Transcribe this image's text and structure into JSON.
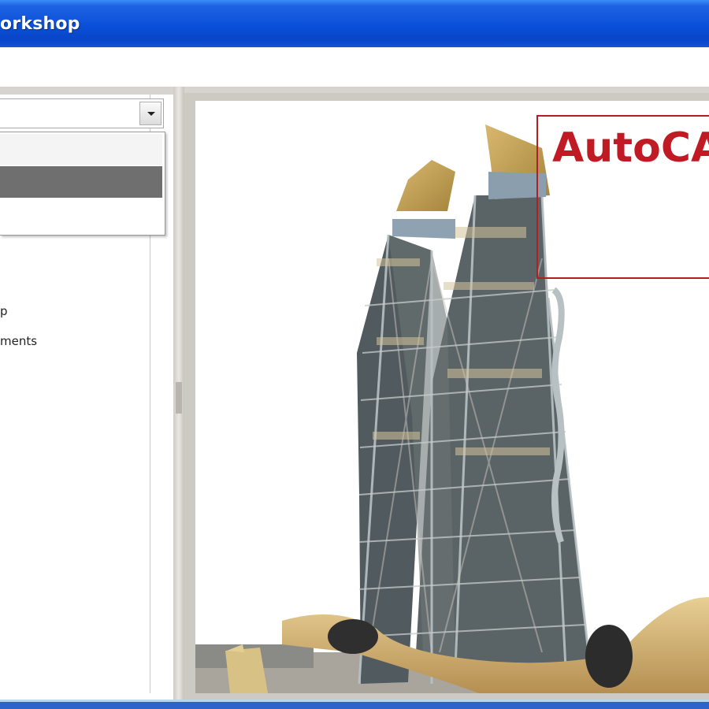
{
  "window": {
    "title": "orkshop"
  },
  "left_panel": {
    "combo_value": "",
    "tree_items": [
      {
        "label": "p"
      },
      {
        "label": "ments"
      }
    ]
  },
  "viewer": {
    "image_name": "tower-image",
    "overlay_text": "AutoCA"
  },
  "colors": {
    "titlebar": "#0a4fd8",
    "overlay_red": "#c01b24",
    "selected_option": "#6f6f6f"
  }
}
